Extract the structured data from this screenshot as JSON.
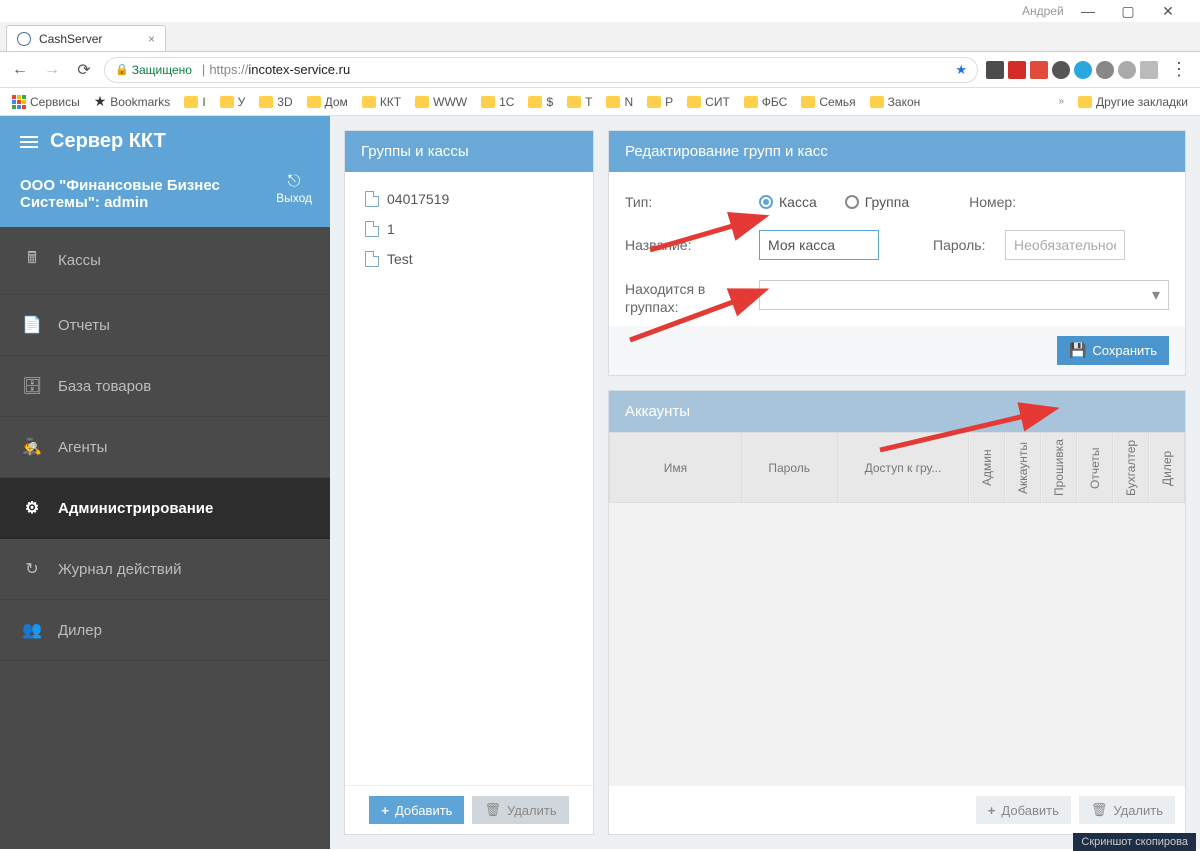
{
  "window": {
    "user": "Андрей"
  },
  "browser": {
    "tab_title": "CashServer",
    "secure_label": "Защищено",
    "url_prefix": "https://",
    "url_host": "incotex-service.ru",
    "bookmarks": {
      "services": "Сервисы",
      "bookmarks": "Bookmarks",
      "items": [
        "I",
        "У",
        "3D",
        "Дом",
        "ККТ",
        "WWW",
        "1С",
        "$",
        "T",
        "N",
        "Р",
        "СИТ",
        "ФБС",
        "Семья",
        "Закон"
      ],
      "other": "Другие закладки"
    }
  },
  "sidebar": {
    "title": "Сервер ККТ",
    "org": "ООО \"Финансовые Бизнес Системы\": admin",
    "logout": "Выход",
    "items": [
      {
        "label": "Кассы"
      },
      {
        "label": "Отчеты"
      },
      {
        "label": "База товаров"
      },
      {
        "label": "Агенты"
      },
      {
        "label": "Администрирование"
      },
      {
        "label": "Журнал действий"
      },
      {
        "label": "Дилер"
      }
    ]
  },
  "groups_panel": {
    "title": "Группы и кассы",
    "items": [
      "04017519",
      "1",
      "Test"
    ],
    "add": "Добавить",
    "del": "Удалить"
  },
  "edit_panel": {
    "title": "Редактирование групп и касс",
    "type_label": "Тип:",
    "type_kassa": "Касса",
    "type_group": "Группа",
    "number_label": "Номер:",
    "name_label": "Название:",
    "name_value": "Моя касса",
    "pass_label": "Пароль:",
    "pass_placeholder": "Необязательное",
    "groups_label": "Находится в группах:",
    "save": "Сохранить"
  },
  "accounts_panel": {
    "title": "Аккаунты",
    "cols": {
      "name": "Имя",
      "pass": "Пароль",
      "access": "Доступ к гру...",
      "admin": "Админ",
      "accounts": "Аккаунты",
      "firmware": "Прошивка",
      "reports": "Отчеты",
      "buh": "Бухгалтер",
      "dealer": "Дилер"
    },
    "add": "Добавить",
    "del": "Удалить"
  },
  "toast": "Скриншот скопирова"
}
